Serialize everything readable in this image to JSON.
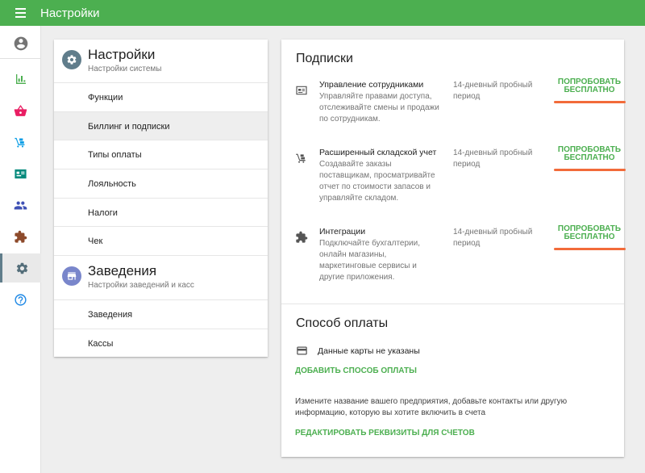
{
  "topbar": {
    "title": "Настройки"
  },
  "sidebar": {
    "items": [
      {
        "icon": "account-circle-icon"
      },
      {
        "icon": "bar-chart-icon"
      },
      {
        "icon": "basket-icon"
      },
      {
        "icon": "dolly-icon"
      },
      {
        "icon": "id-card-icon"
      },
      {
        "icon": "people-icon"
      },
      {
        "icon": "puzzle-icon"
      },
      {
        "icon": "gear-icon",
        "active": true
      },
      {
        "icon": "help-icon"
      }
    ]
  },
  "settings_section": {
    "title": "Настройки",
    "subtitle": "Настройки системы",
    "items": [
      "Функции",
      "Биллинг и подписки",
      "Типы оплаты",
      "Лояльность",
      "Налоги",
      "Чек"
    ],
    "active_index": 1
  },
  "venues_section": {
    "title": "Заведения",
    "subtitle": "Настройки заведений и касс",
    "items": [
      "Заведения",
      "Кассы"
    ]
  },
  "subscriptions": {
    "title": "Подписки",
    "items": [
      {
        "name": "Управление сотрудниками",
        "description": "Управляйте правами доступа, отслеживайте смены и продажи по сотрудникам.",
        "trial": "14-дневный пробный период",
        "button_line1": "ПОПРОБОВАТЬ",
        "button_line2": "БЕСПЛАТНО",
        "icon": "id-card-icon"
      },
      {
        "name": "Расширенный складской учет",
        "description": "Создавайте заказы поставщикам, просматривайте отчет по стоимости запасов и управляйте складом.",
        "trial": "14-дневный пробный период",
        "button_line1": "ПОПРОБОВАТЬ",
        "button_line2": "БЕСПЛАТНО",
        "icon": "dolly-icon"
      },
      {
        "name": "Интеграции",
        "description": "Подключайте бухгалтерии, онлайн магазины, маркетинговые сервисы и другие приложения.",
        "trial": "14-дневный пробный период",
        "button_line1": "ПОПРОБОВАТЬ",
        "button_line2": "БЕСПЛАТНО",
        "icon": "puzzle-icon"
      }
    ]
  },
  "payment": {
    "title": "Способ оплаты",
    "card_text": "Данные карты не указаны",
    "add_link": "ДОБАВИТЬ СПОСОБ ОПЛАТЫ",
    "info_text": "Измените название вашего предприятия, добавьте контакты или другую информацию, которую вы хотите включить в счета",
    "edit_link": "РЕДАКТИРОВАТЬ РЕКВИЗИТЫ ДЛЯ СЧЕТОВ"
  },
  "colors": {
    "topbar": "#4caf50",
    "accent_green": "#4caf50",
    "highlight_orange": "#f26b3a",
    "settings_icon_bg": "#607d8b",
    "venues_icon_bg": "#7986cb"
  }
}
